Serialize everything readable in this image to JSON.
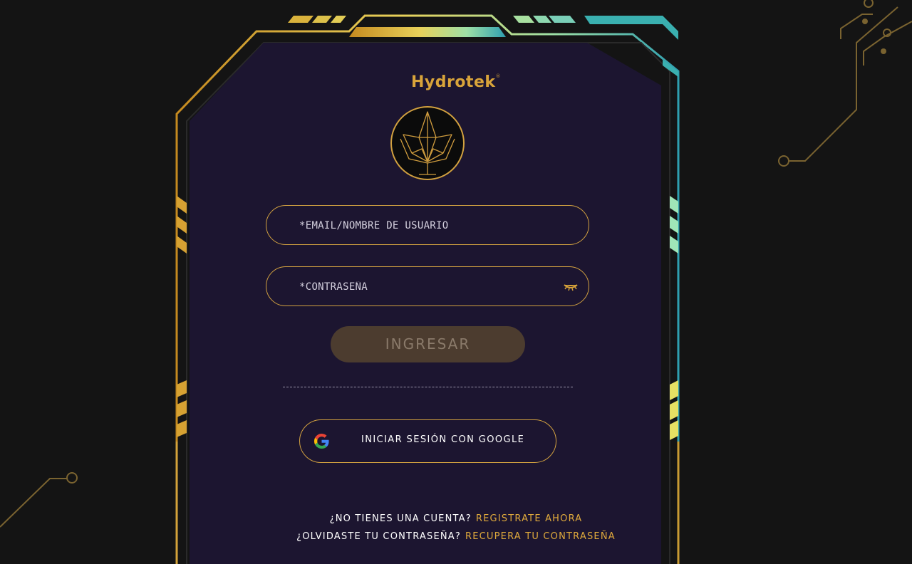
{
  "brand": {
    "name": "Hydrotek",
    "mark": "®"
  },
  "form": {
    "email_placeholder": "*EMAIL/NOMBRE DE USUARIO",
    "password_placeholder": "*CONTRASEÑA",
    "submit_label": "INGRESAR",
    "google_label": "INICIAR SESIÓN CON GOOGLE"
  },
  "footer": {
    "register_question": "¿NO TIENES UNA CUENTA?",
    "register_link": "REGISTRATE AHORA",
    "forgot_question": "¿OLVIDASTE TU CONTRASEÑA?",
    "forgot_link": "RECUPERA TU CONTRASEÑA"
  },
  "icons": {
    "logo": "crystal-plant-logo-icon",
    "password_toggle": "closed-eye-icon",
    "google": "google-icon"
  },
  "colors": {
    "background": "#141414",
    "panel": "#1c1530",
    "gold": "#d2a140",
    "link": "#e0aa3c",
    "teal": "#3ab0b0",
    "button_bg": "#4c3c2f",
    "button_text": "#8a7a6a"
  }
}
